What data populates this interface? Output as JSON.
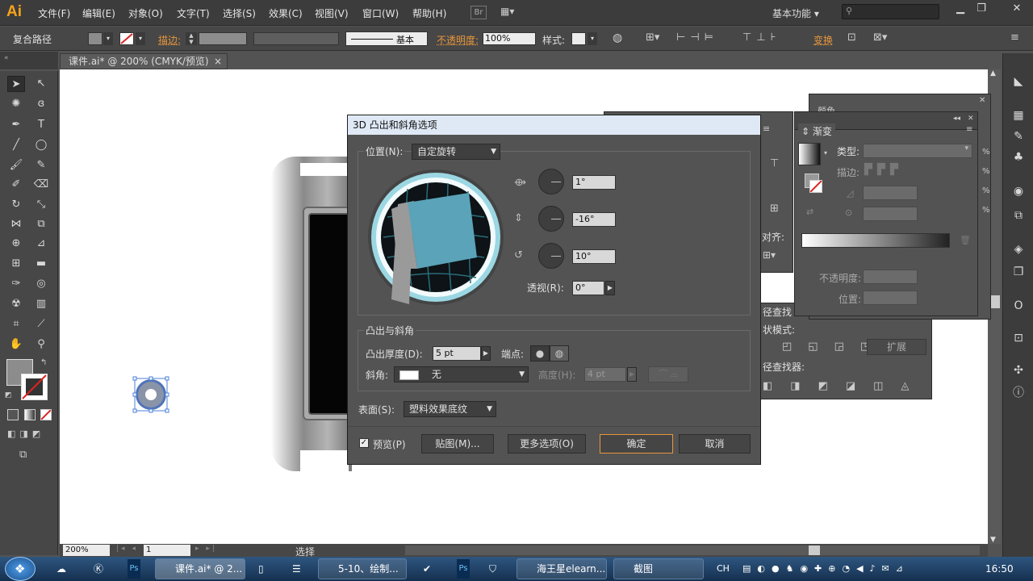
{
  "app": {
    "logo": "Ai",
    "workspace": "基本功能 ▾"
  },
  "menu": [
    "文件(F)",
    "编辑(E)",
    "对象(O)",
    "文字(T)",
    "选择(S)",
    "效果(C)",
    "视图(V)",
    "窗口(W)",
    "帮助(H)"
  ],
  "menu_extra": {
    "br": "Br"
  },
  "search": {
    "placeholder": ""
  },
  "control_bar": {
    "object_type": "复合路径",
    "stroke_label": "描边:",
    "stroke_style": "基本",
    "opacity_label": "不透明度:",
    "opacity_value": "100%",
    "style_label": "样式:",
    "transform_label": "变换"
  },
  "doc_tab": {
    "title": "课件.ai* @ 200% (CMYK/预览)",
    "close": "×"
  },
  "status": {
    "zoom": "200%",
    "page": "1",
    "tool": "选择"
  },
  "dialog": {
    "title": "3D 凸出和斜角选项",
    "position_label": "位置(N):",
    "position_value": "自定旋转",
    "rot_x": "1°",
    "rot_y": "-16°",
    "rot_z": "10°",
    "perspective_label": "透视(R):",
    "perspective_value": "0°",
    "extrude_group": "凸出与斜角",
    "depth_label": "凸出厚度(D):",
    "depth_value": "5 pt",
    "cap_label": "端点:",
    "bevel_label": "斜角:",
    "bevel_value": "无",
    "height_label": "高度(H):",
    "height_value": "4 pt",
    "surface_label": "表面(S):",
    "surface_value": "塑料效果底纹",
    "preview_label": "预览(P)",
    "map_button": "贴图(M)...",
    "more_button": "更多选项(O)",
    "ok_button": "确定",
    "cancel_button": "取消"
  },
  "gradient_panel": {
    "title": "渐变",
    "type_label": "类型:",
    "stroke_label": "描边:",
    "opacity_label": "不透明度:",
    "position_label": "位置:"
  },
  "pathfinder_panel": {
    "align_label": "对齐:",
    "pathfinder_tab": "径查找",
    "shape_modes_label": "状模式:",
    "expand_button": "扩展",
    "pathfinder_label": "径查找器:",
    "tab_fragment": "颜色"
  },
  "taskbar": {
    "items": [
      "课件.ai* @ 2...",
      "5-10、绘制...",
      "海王星elearn...",
      "截图"
    ],
    "lang": "CH",
    "time": "16:50"
  },
  "colors": {
    "accent": "#e8963b",
    "dialog_title_bg": "#dfe9f5",
    "cube_face": "#5aa3b8"
  }
}
